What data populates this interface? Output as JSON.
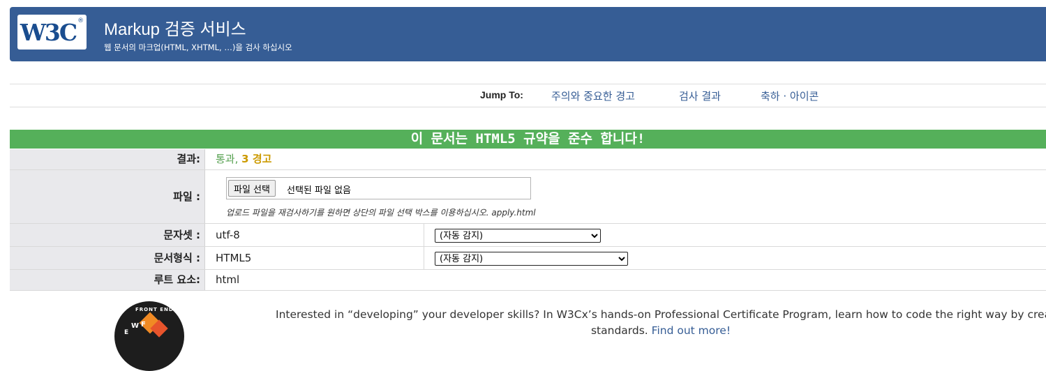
{
  "header": {
    "logo_text": "W3C",
    "logo_mark": "®",
    "title": "Markup 검증 서비스",
    "subtitle": "웹 문서의 마크업(HTML, XHTML, …)을 검사 하십시오"
  },
  "jump": {
    "label": "Jump To:",
    "links": [
      "주의와 중요한 경고",
      "검사 결과",
      "축하 · 아이콘"
    ]
  },
  "banner": "이 문서는 HTML5 규약을 준수 합니다!",
  "result": {
    "label": "결과:",
    "pass": "통과,",
    "warnings": "3 경고"
  },
  "file": {
    "label": "파일 :",
    "button": "파일 선택",
    "no_file": "선택된 파일 없음",
    "hint": "업로드 파일을 재검사하기를 원하면 상단의 파일 선택 박스를 이용하십시오. apply.html"
  },
  "charset": {
    "label": "문자셋 :",
    "value": "utf-8",
    "select": "(자동 감지)"
  },
  "doctype": {
    "label": "문서형식 :",
    "value": "HTML5",
    "select": "(자동 감지)"
  },
  "root": {
    "label": "루트 요소:",
    "value": "html"
  },
  "promo": {
    "text": "Interested in “developing” your developer skills? In W3Cx’s hands-on Professional Certificate Program, learn how to code the right way by creating W",
    "text2": "standards.",
    "link": "Find out more!",
    "badge_text": "FRONT END",
    "badge_letters": [
      "E",
      "W",
      "F"
    ]
  },
  "colors": {
    "header_bg": "#365d95",
    "banner_bg": "#55b05a",
    "pass": "#55a04f",
    "warn": "#cc9a00"
  }
}
